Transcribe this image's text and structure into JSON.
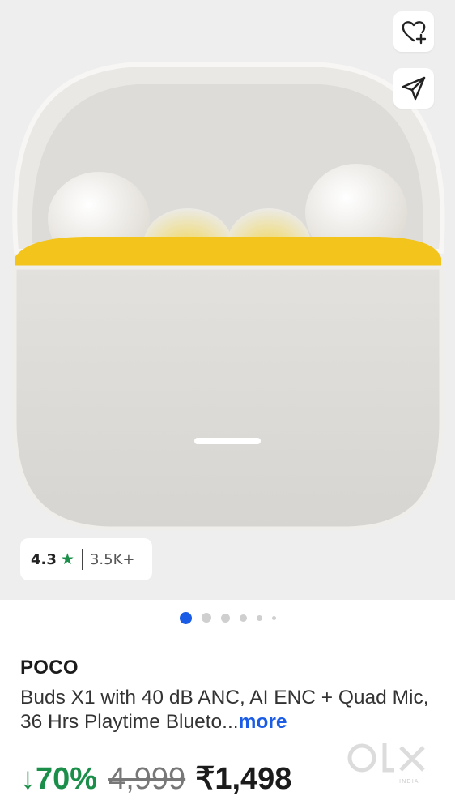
{
  "hero": {
    "image_alt": "",
    "wishlist_icon": "heart-plus-icon",
    "share_icon": "send-icon"
  },
  "rating": {
    "value": "4.3",
    "star": "★",
    "count": "3.5K+",
    "star_color": "#1b8f4a"
  },
  "carousel": {
    "active_index": 0,
    "dot_count": 6,
    "active_color": "#1a5ce5"
  },
  "product": {
    "brand": "POCO",
    "title": "Buds X1 with 40 dB ANC, AI ENC + Quad Mic, 36 Hrs Playtime Blueto...",
    "more_label": "more"
  },
  "pricing": {
    "discount": "↓70%",
    "mrp": "4,999",
    "price": "₹1,498",
    "discount_color": "#1b8f4a"
  },
  "watermark": {
    "text": "olx",
    "subtext": "INDIA"
  }
}
